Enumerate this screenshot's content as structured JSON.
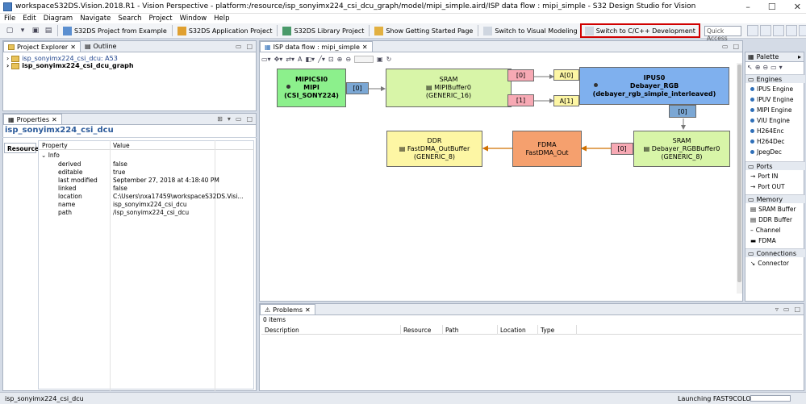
{
  "window": {
    "title": "workspaceS32DS.Vision.2018.R1 - Vision Perspective - platform:/resource/isp_sonyimx224_csi_dcu_graph/model/mipi_simple.aird/ISP data flow : mipi_simple - S32 Design Studio for Vision"
  },
  "menu": [
    "File",
    "Edit",
    "Diagram",
    "Navigate",
    "Search",
    "Project",
    "Window",
    "Help"
  ],
  "toolbar": {
    "btn1": "S32DS Project from Example",
    "btn2": "S32DS Application Project",
    "btn3": "S32DS Library Project",
    "btn4": "Show Getting Started Page",
    "btn5": "Switch to Visual Modeling",
    "btn6": "Switch to C/C++ Development",
    "quick_access": "Quick Access"
  },
  "left_tabs": {
    "explorer": "Project Explorer",
    "outline": "Outline"
  },
  "tree": [
    {
      "label": "isp_sonyimx224_csi_dcu: A53"
    },
    {
      "label": "isp_sonyimx224_csi_dcu_graph"
    }
  ],
  "properties": {
    "tab": "Properties",
    "title": "isp_sonyimx224_csi_dcu",
    "side_tab": "Resource",
    "col_property": "Property",
    "col_value": "Value",
    "group": "Info",
    "rows": [
      {
        "k": "derived",
        "v": "false"
      },
      {
        "k": "editable",
        "v": "true"
      },
      {
        "k": "last modified",
        "v": "September 27, 2018 at 4:18:40 PM"
      },
      {
        "k": "linked",
        "v": "false"
      },
      {
        "k": "location",
        "v": "C:\\Users\\nxa17459\\workspaceS32DS.Visi..."
      },
      {
        "k": "name",
        "v": "isp_sonyimx224_csi_dcu"
      },
      {
        "k": "path",
        "v": "/isp_sonyimx224_csi_dcu"
      }
    ]
  },
  "editor": {
    "tab": "ISP data flow : mipi_simple",
    "nodes": {
      "mipi": {
        "l1": "MIPICSI0",
        "l2": "MIPI",
        "l3": "(CSI_SONY224)",
        "port": "[0]"
      },
      "sram1": {
        "l1": "SRAM",
        "l2": "MIPIBuffer0",
        "l3": "(GENERIC_16)",
        "p0": "[0]",
        "p1": "[1]"
      },
      "ipus": {
        "l1": "IPUS0",
        "l2": "Debayer_RGB",
        "l3": "(debayer_rgb_simple_interleaved)",
        "a0": "A[0]",
        "a1": "A[1]",
        "port": "[0]"
      },
      "sram2": {
        "l1": "SRAM",
        "l2": "Debayer_RGBBuffer0",
        "l3": "(GENERIC_8)",
        "port": "[0]"
      },
      "fdma": {
        "l1": "FDMA",
        "l2": "FastDMA_Out"
      },
      "ddr": {
        "l1": "DDR",
        "l2": "FastDMA_OutBuffer",
        "l3": "(GENERIC_8)"
      }
    },
    "colors": {
      "mipi": "#8cf08c",
      "sram": "#d8f5a8",
      "ipus": "#7fb0ee",
      "fdma": "#f5a06e",
      "ddr": "#fdf6a4",
      "port_blue": "#7ba7d4",
      "port_pink": "#f7a9b4",
      "port_yellow": "#fdf6a4"
    }
  },
  "palette": {
    "tab": "Palette",
    "sections": [
      {
        "name": "Engines",
        "items": [
          "IPUS Engine",
          "IPUV Engine",
          "MIPI Engine",
          "VIU Engine",
          "H264Enc",
          "H264Dec",
          "JpegDec"
        ]
      },
      {
        "name": "Ports",
        "items": [
          "Port IN",
          "Port OUT"
        ]
      },
      {
        "name": "Memory",
        "items": [
          "SRAM Buffer",
          "DDR Buffer",
          "Channel",
          "FDMA"
        ]
      },
      {
        "name": "Connections",
        "items": [
          "Connector"
        ]
      }
    ]
  },
  "problems": {
    "tab": "Problems",
    "count": "0 items",
    "cols": [
      "Description",
      "Resource",
      "Path",
      "Location",
      "Type"
    ]
  },
  "status": {
    "left": "isp_sonyimx224_csi_dcu",
    "right": "Launching FAST9COLOR"
  }
}
